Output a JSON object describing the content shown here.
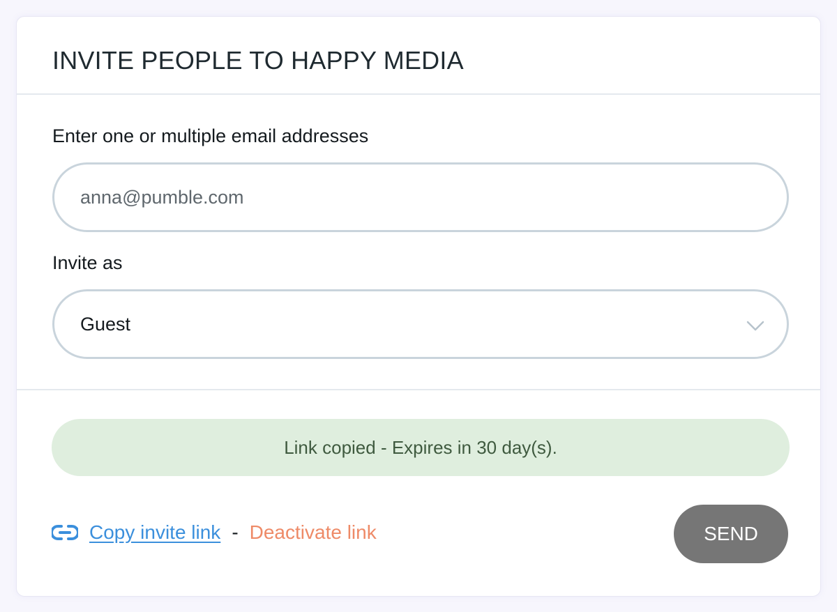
{
  "modal": {
    "title": "INVITE PEOPLE TO HAPPY MEDIA"
  },
  "email_field": {
    "label": "Enter one or multiple email addresses",
    "placeholder": "anna@pumble.com",
    "value": ""
  },
  "role_field": {
    "label": "Invite as",
    "selected": "Guest",
    "icon": "chevron-down-icon"
  },
  "status": {
    "message": "Link copied - Expires in 30 day(s)."
  },
  "actions": {
    "link_icon": "link-icon",
    "copy_link_label": "Copy invite link",
    "separator": "-",
    "deactivate_label": "Deactivate link",
    "send_label": "SEND"
  },
  "colors": {
    "accent_link": "#3b8fdc",
    "danger_link": "#ee8a67",
    "success_banner": "#dfeede",
    "send_button": "#767676"
  }
}
